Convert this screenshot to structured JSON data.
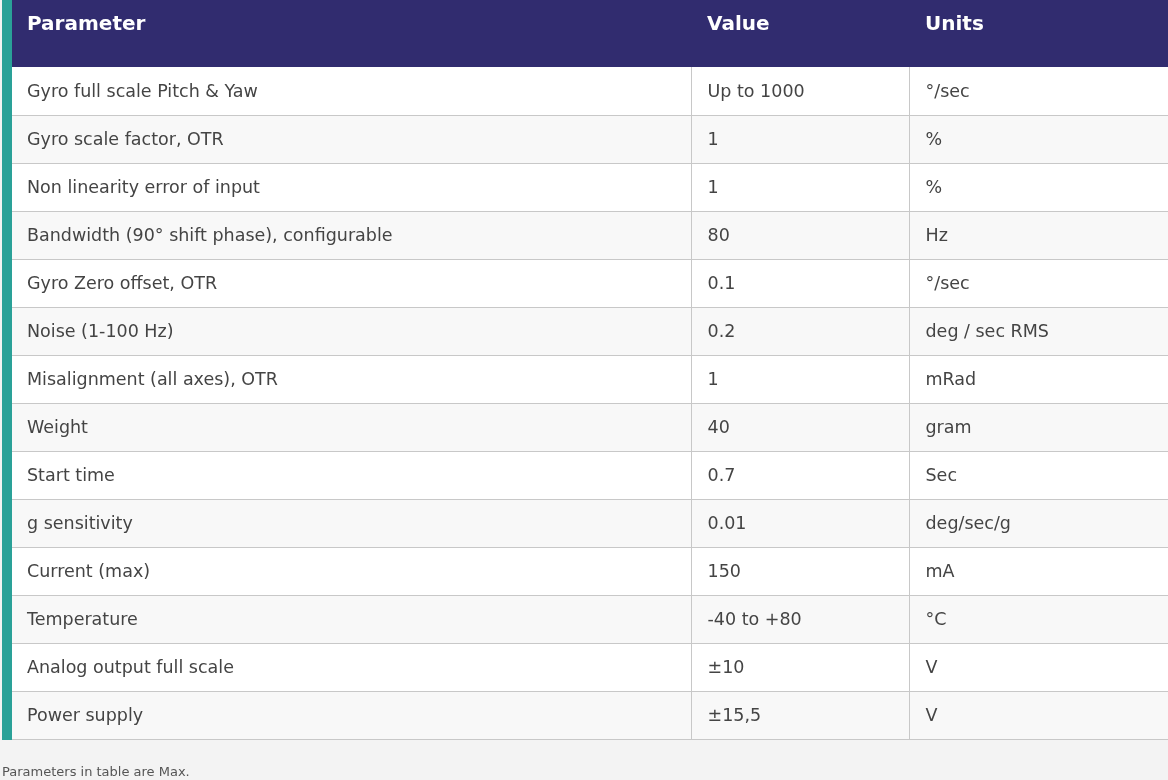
{
  "table": {
    "columns": [
      "Parameter",
      "Value",
      "Units"
    ],
    "rows": [
      [
        "Gyro full scale Pitch & Yaw",
        "Up to 1000",
        "°/sec"
      ],
      [
        "Gyro scale factor, OTR",
        "1",
        "%"
      ],
      [
        "Non linearity error of input",
        "1",
        "%"
      ],
      [
        "Bandwidth (90° shift phase), configurable",
        "80",
        "Hz"
      ],
      [
        "Gyro Zero offset, OTR",
        "0.1",
        "°/sec"
      ],
      [
        "Noise (1-100 Hz)",
        "0.2",
        "deg / sec RMS"
      ],
      [
        "Misalignment (all axes), OTR",
        "1",
        "mRad"
      ],
      [
        "Weight",
        "40",
        "gram"
      ],
      [
        "Start time",
        "0.7",
        "Sec"
      ],
      [
        "g sensitivity",
        "0.01",
        "deg/sec/g"
      ],
      [
        "Current (max)",
        "150",
        "mA"
      ],
      [
        "Temperature",
        "-40 to +80",
        "°C"
      ],
      [
        "Analog output full scale",
        "±10",
        "V"
      ],
      [
        "Power supply",
        "±15,5",
        "V"
      ]
    ]
  },
  "footnote": "Parameters in table are Max."
}
